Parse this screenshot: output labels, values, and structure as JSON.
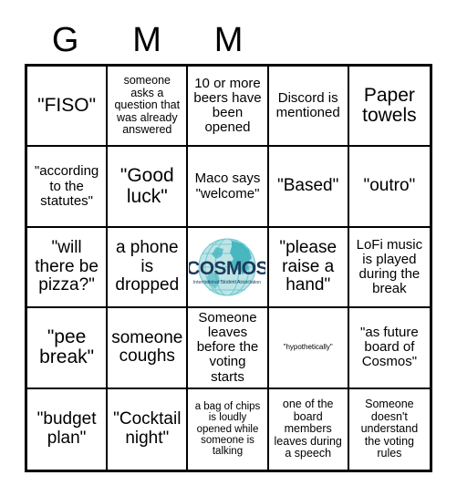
{
  "header": {
    "letters": [
      "G",
      "M",
      "M",
      "",
      ""
    ]
  },
  "grid": {
    "rows": 5,
    "columns": 5,
    "cells": [
      {
        "text": "\"FISO\"",
        "size": "xl"
      },
      {
        "text": "someone asks a question that was already answered",
        "size": "sm"
      },
      {
        "text": "10 or more beers have been opened",
        "size": "md"
      },
      {
        "text": "Discord is mentioned",
        "size": "md"
      },
      {
        "text": "Paper towels",
        "size": "xl"
      },
      {
        "text": "\"according to the statutes\"",
        "size": "md"
      },
      {
        "text": "\"Good luck\"",
        "size": "xl"
      },
      {
        "text": "Maco says \"welcome\"",
        "size": "md"
      },
      {
        "text": "\"Based\"",
        "size": "lg"
      },
      {
        "text": "\"outro\"",
        "size": "lg"
      },
      {
        "text": "\"will there be pizza?\"",
        "size": "lg"
      },
      {
        "text": "a phone is dropped",
        "size": "lg"
      },
      {
        "text": "",
        "size": "md",
        "logo": true
      },
      {
        "text": "\"please raise a hand\"",
        "size": "lg"
      },
      {
        "text": "LoFi music is played during the break",
        "size": "md"
      },
      {
        "text": "\"pee break\"",
        "size": "xl"
      },
      {
        "text": "someone coughs",
        "size": "lg"
      },
      {
        "text": "Someone leaves before the voting starts",
        "size": "md"
      },
      {
        "text": "\"hypothetically\"",
        "size": "tiny"
      },
      {
        "text": "\"as future board of Cosmos\"",
        "size": "md"
      },
      {
        "text": "\"budget plan\"",
        "size": "lg"
      },
      {
        "text": "\"Cocktail night\"",
        "size": "lg"
      },
      {
        "text": "a bag of chips is loudly opened while someone is talking",
        "size": "xs"
      },
      {
        "text": "one of the board members leaves during a speech",
        "size": "sm"
      },
      {
        "text": "Someone doesn't understand the voting rules",
        "size": "sm"
      }
    ]
  },
  "logo": {
    "wordmark": "COSMOS",
    "tagline": "International Student Association",
    "globe_color": "#6fc9cf",
    "globe_light": "#bfe4e6",
    "landmass_color": "#3fb3bd",
    "wordmark_color": "#1d3a5c",
    "tagline_color": "#1d3a5c"
  },
  "colors": {
    "background": "#ffffff",
    "grid_line": "#000000",
    "text": "#000000"
  }
}
